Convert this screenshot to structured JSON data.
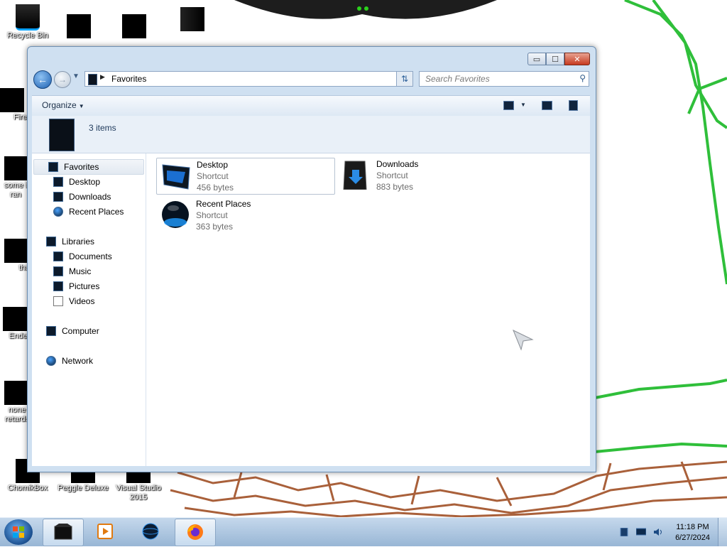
{
  "desktop": {
    "icons": [
      {
        "label": "Recycle Bin",
        "icon": "recycle-bin-icon"
      },
      {
        "label": "",
        "icon": "redacted-icon"
      },
      {
        "label": "",
        "icon": "redacted-icon"
      },
      {
        "label": "",
        "icon": "redacted-icon"
      },
      {
        "label": "Fire",
        "icon": "redacted-icon"
      },
      {
        "label": "some i ran",
        "icon": "redacted-icon"
      },
      {
        "label": "that bu",
        "icon": "redacted-icon"
      },
      {
        "label": "Ender",
        "icon": "redacted-icon"
      },
      {
        "label": "none retards",
        "icon": "redacted-icon"
      },
      {
        "label": "ChomikBox",
        "icon": "redacted-icon"
      },
      {
        "label": "Peggle Deluxe",
        "icon": "redacted-icon"
      },
      {
        "label": "Visual Studio 2015",
        "icon": "redacted-icon"
      }
    ]
  },
  "window": {
    "caption_buttons": {
      "minimize": "▭",
      "maximize": "☐",
      "close": "✕"
    },
    "address": {
      "path": "Favorites"
    },
    "search": {
      "placeholder": "Search Favorites"
    },
    "toolbar": {
      "organize_label": "Organize"
    },
    "details": {
      "count": "3 items"
    },
    "nav_pane": {
      "groups": [
        {
          "label": "Favorites",
          "icon": "star-icon",
          "items": [
            {
              "label": "Desktop",
              "icon": "desktop-icon"
            },
            {
              "label": "Downloads",
              "icon": "downloads-icon"
            },
            {
              "label": "Recent Places",
              "icon": "recent-places-icon"
            }
          ]
        },
        {
          "label": "Libraries",
          "icon": "library-icon",
          "items": [
            {
              "label": "Documents",
              "icon": "documents-icon"
            },
            {
              "label": "Music",
              "icon": "music-icon"
            },
            {
              "label": "Pictures",
              "icon": "pictures-icon"
            },
            {
              "label": "Videos",
              "icon": "videos-icon"
            }
          ]
        },
        {
          "label": "Computer",
          "icon": "computer-icon",
          "items": []
        },
        {
          "label": "Network",
          "icon": "network-icon",
          "items": []
        }
      ]
    },
    "files": [
      {
        "name": "Desktop",
        "type": "Shortcut",
        "size": "456 bytes",
        "icon": "desktop-shortcut-icon"
      },
      {
        "name": "Downloads",
        "type": "Shortcut",
        "size": "883 bytes",
        "icon": "downloads-shortcut-icon"
      },
      {
        "name": "Recent Places",
        "type": "Shortcut",
        "size": "363 bytes",
        "icon": "recent-places-shortcut-icon"
      }
    ]
  },
  "taskbar": {
    "buttons": [
      {
        "icon": "explorer-icon",
        "open": true
      },
      {
        "icon": "media-player-icon",
        "open": false
      },
      {
        "icon": "globe-icon",
        "open": false
      },
      {
        "icon": "firefox-icon",
        "open": true
      }
    ],
    "clock": {
      "time": "11:18 PM",
      "date": "6/27/2024"
    }
  },
  "colors": {
    "accent": "#2a5e98",
    "window_frame": "#cfe0f1",
    "green_drawing": "#2fbf3a",
    "brown_drawing": "#a0522d"
  }
}
